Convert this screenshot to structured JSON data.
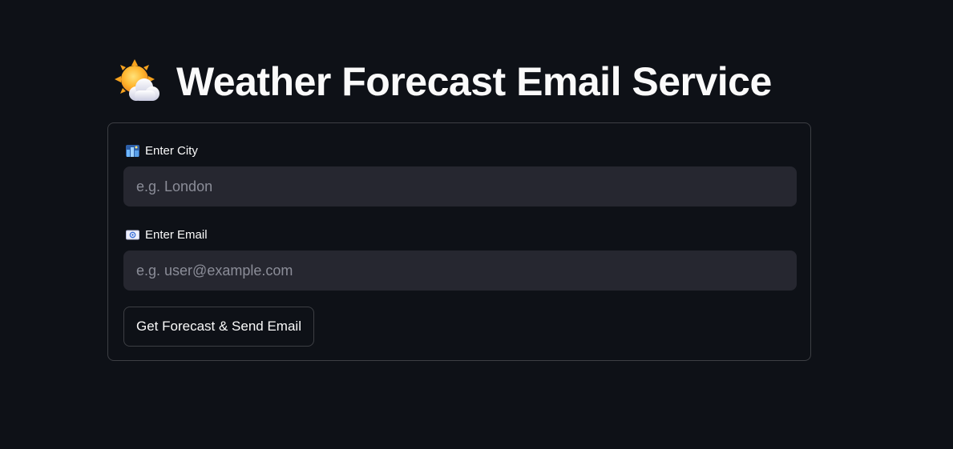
{
  "header": {
    "title": "Weather Forecast Email Service",
    "icon": "sun-behind-cloud-icon"
  },
  "form": {
    "city": {
      "label": "Enter City",
      "icon": "cityscape-icon",
      "placeholder": "e.g. London",
      "value": ""
    },
    "email": {
      "label": "Enter Email",
      "icon": "email-icon",
      "placeholder": "e.g. user@example.com",
      "value": ""
    },
    "submit_label": "Get Forecast & Send Email"
  },
  "colors": {
    "background": "#0e1117",
    "input_background": "#262730",
    "text": "#fafafa",
    "placeholder": "#8b8d98",
    "border": "rgba(250,250,250,0.2)"
  }
}
